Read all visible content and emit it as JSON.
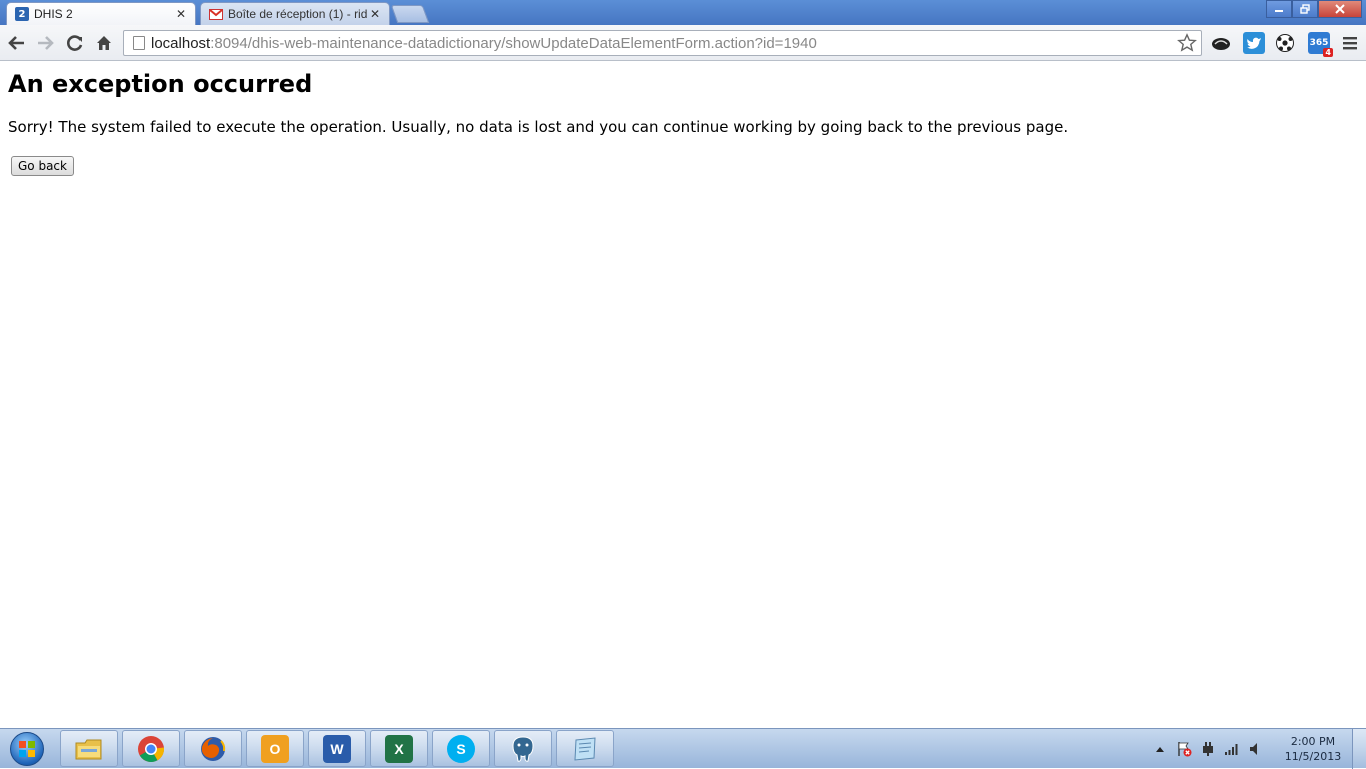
{
  "tabs": [
    {
      "title": "DHIS 2",
      "favicon": "dhis-icon",
      "active": true
    },
    {
      "title": "Boîte de réception (1) - rid",
      "favicon": "gmail-icon",
      "active": false
    }
  ],
  "favicon_text": {
    "dhis": "2"
  },
  "window_controls": {
    "minimize": "minimize-icon",
    "restore": "restore-icon",
    "close": "close-icon"
  },
  "toolbar": {
    "url_host": "localhost",
    "url_rest": ":8094/dhis-web-maintenance-datadictionary/showUpdateDataElementForm.action?id=1940",
    "extensions": [
      {
        "name": "cloud-icon"
      },
      {
        "name": "twitter-icon"
      },
      {
        "name": "soccer-ball-icon"
      },
      {
        "name": "calendar-365-icon",
        "label": "365",
        "badge": "4"
      }
    ]
  },
  "page": {
    "heading": "An exception occurred",
    "message": "Sorry! The system failed to execute the operation. Usually, no data is lost and you can continue working by going back to the previous page.",
    "button_label": "Go back"
  },
  "taskbar": {
    "apps": [
      {
        "name": "explorer-icon"
      },
      {
        "name": "chrome-icon"
      },
      {
        "name": "firefox-icon"
      },
      {
        "name": "outlook-icon",
        "label": "O"
      },
      {
        "name": "word-icon",
        "label": "W"
      },
      {
        "name": "excel-icon",
        "label": "X"
      },
      {
        "name": "skype-icon",
        "label": "S"
      },
      {
        "name": "postgresql-icon"
      },
      {
        "name": "notepad-icon"
      }
    ],
    "clock_time": "2:00 PM",
    "clock_date": "11/5/2013"
  }
}
